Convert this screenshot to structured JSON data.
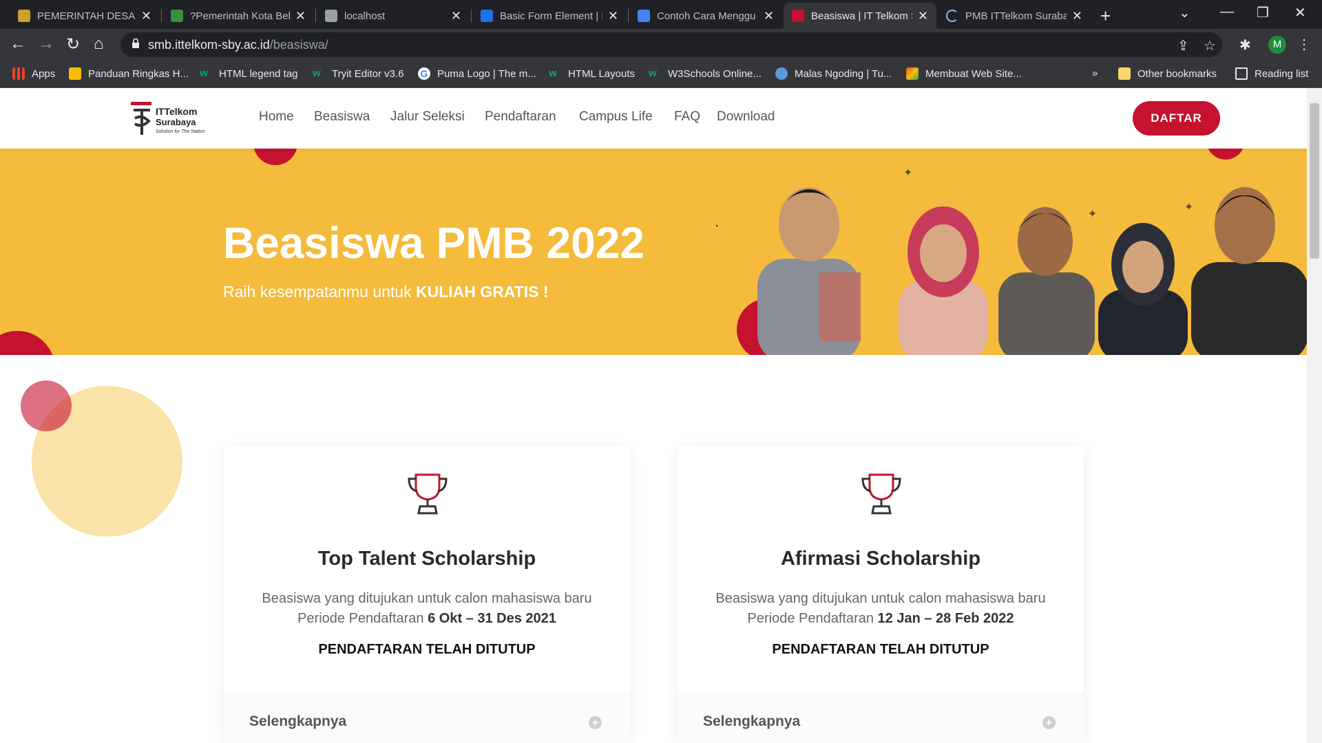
{
  "browser": {
    "tabs": [
      {
        "title": "PEMERINTAH DESA - I",
        "color": "#c9a227"
      },
      {
        "title": "?Pemerintah Kota Bek",
        "color": "#3c8d3f"
      },
      {
        "title": "localhost",
        "color": "#9aa0a6"
      },
      {
        "title": "Basic Form Element | I",
        "color": "#1a73e8"
      },
      {
        "title": "Contoh Cara Menggu",
        "color": "#4285f4"
      },
      {
        "title": "Beasiswa | IT Telkom S",
        "color": "#c4122f"
      },
      {
        "title": "PMB ITTelkom Suraba",
        "color": "#8ab4f8"
      }
    ],
    "new_tab": "+",
    "url_host": "smb.ittelkom-sby.ac.id",
    "url_path": "/beasiswa/",
    "profile_initial": "M",
    "bookmarks": [
      {
        "label": "Apps",
        "color": "#ea4335"
      },
      {
        "label": "Panduan Ringkas H...",
        "color": "#fbbc04"
      },
      {
        "label": "HTML legend tag",
        "color": "#04aa6d"
      },
      {
        "label": "Tryit Editor v3.6",
        "color": "#04aa6d"
      },
      {
        "label": "Puma Logo | The m...",
        "color": "#4285f4"
      },
      {
        "label": "HTML Layouts",
        "color": "#04aa6d"
      },
      {
        "label": "W3Schools Online...",
        "color": "#04aa6d"
      },
      {
        "label": "Malas Ngoding | Tu...",
        "color": "#5b9bd5"
      },
      {
        "label": "Membuat Web Site...",
        "color": "#e94e1b"
      }
    ],
    "bookmarks_overflow": "»",
    "other_bookmarks": "Other bookmarks",
    "reading_list": "Reading list"
  },
  "site": {
    "logo_line1": "ITTelkom",
    "logo_line2": "Surabaya",
    "logo_tagline": "Solution for The Nation",
    "nav": [
      "Home",
      "Beasiswa",
      "Jalur Seleksi",
      "Pendaftaran",
      "Campus Life",
      "FAQ",
      "Download"
    ],
    "cta": "DAFTAR",
    "accent": "#c4122f",
    "hero_bg": "#f4bb3c"
  },
  "hero": {
    "title": "Beasiswa PMB 2022",
    "sub_prefix": "Raih kesempatanmu untuk ",
    "sub_bold": "KULIAH GRATIS !"
  },
  "cards": [
    {
      "title": "Top Talent Scholarship",
      "desc_line1": "Beasiswa yang ditujukan untuk calon mahasiswa baru",
      "desc_prefix": "Periode Pendaftaran ",
      "desc_period": "6 Okt – 31 Des 2021",
      "status": "PENDAFTARAN TELAH DITUTUP",
      "more": "Selengkapnya"
    },
    {
      "title": "Afirmasi Scholarship",
      "desc_line1": "Beasiswa yang ditujukan untuk calon mahasiswa baru",
      "desc_prefix": "Periode Pendaftaran ",
      "desc_period": "12 Jan – 28 Feb 2022",
      "status": "PENDAFTARAN TELAH DITUTUP",
      "more": "Selengkapnya"
    }
  ]
}
